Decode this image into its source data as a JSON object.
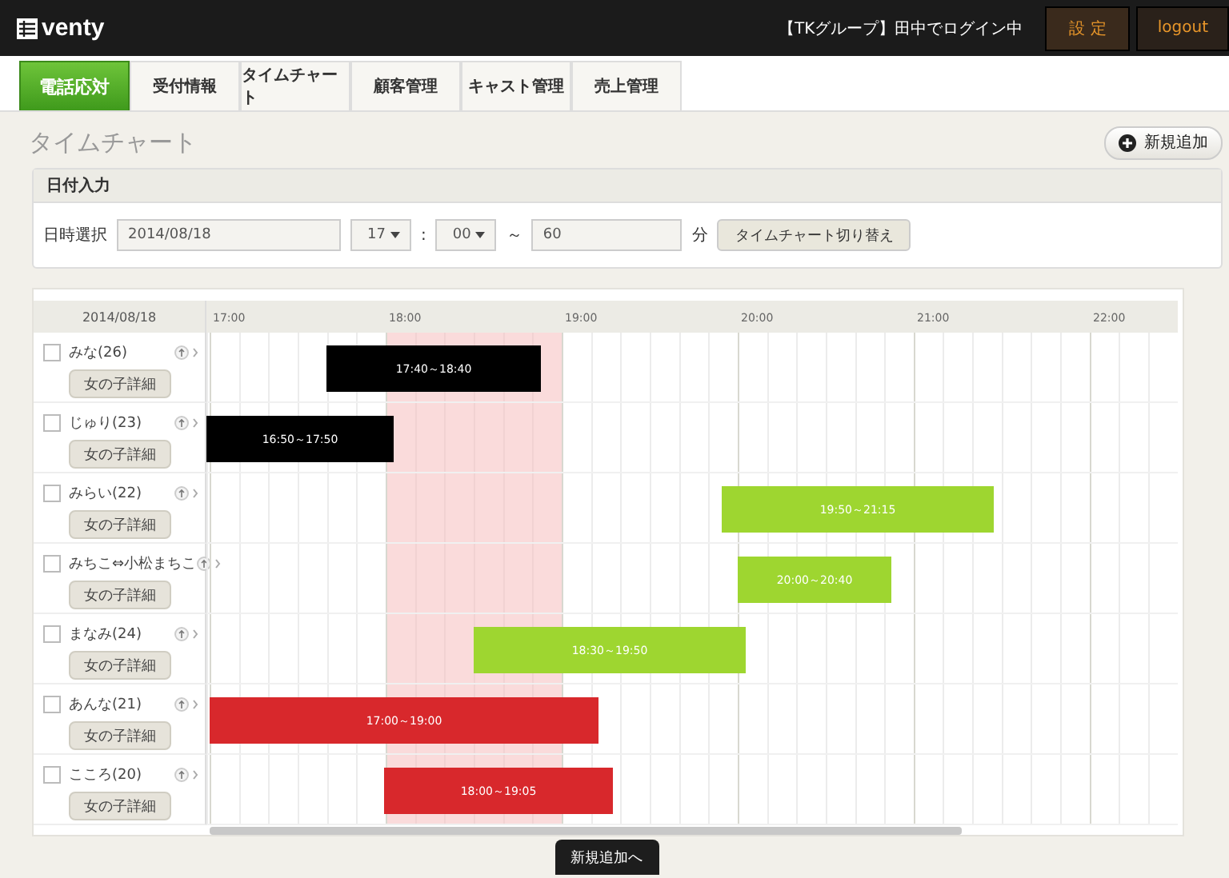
{
  "header": {
    "logo": "venty",
    "login_status": "【TKグループ】田中でログイン中",
    "buttons": [
      "設 定",
      "logout"
    ]
  },
  "tabs": [
    {
      "label": "電話応対",
      "selected": true
    },
    {
      "label": "受付情報",
      "selected": false
    },
    {
      "label": "タイムチャート",
      "selected": false
    },
    {
      "label": "顧客管理",
      "selected": false
    },
    {
      "label": "キャスト管理",
      "selected": false
    },
    {
      "label": "売上管理",
      "selected": false
    }
  ],
  "page_title": "タイムチャート",
  "add_button": "新規追加",
  "date_panel": {
    "title": "日付入力",
    "label": "日時選択",
    "date": "2014/08/18",
    "hour": "17",
    "time_sep": ":",
    "minute": "00",
    "range_sep": "～",
    "duration": "60",
    "unit": "分",
    "switch_button": "タイムチャート切り替え"
  },
  "chart": {
    "date": "2014/08/18",
    "hours": [
      {
        "label": "17:00",
        "highlighted": false
      },
      {
        "label": "18:00",
        "highlighted": true
      },
      {
        "label": "19:00",
        "highlighted": false
      },
      {
        "label": "20:00",
        "highlighted": false
      },
      {
        "label": "21:00",
        "highlighted": false
      },
      {
        "label": "22:00",
        "highlighted": false
      }
    ],
    "casts": [
      {
        "name": "みな(26)",
        "checked": false,
        "detail_button": "女の子詳細",
        "booking": {
          "label": "17:40～18:40",
          "color": "#000000"
        }
      },
      {
        "name": "じゅり(23)",
        "checked": false,
        "detail_button": "女の子詳細",
        "booking": {
          "label": "16:50～17:50",
          "color": "#000000"
        }
      },
      {
        "name": "みらい(22)",
        "checked": false,
        "detail_button": "女の子詳細",
        "booking": {
          "label": "19:50～21:15",
          "color": "#9ed630"
        }
      },
      {
        "name": "みちこ⇔小松まちこ",
        "checked": false,
        "detail_button": "女の子詳細",
        "booking": {
          "label": "20:00～20:40",
          "color": "#9ed630"
        }
      },
      {
        "name": "まなみ(24)",
        "checked": false,
        "detail_button": "女の子詳細",
        "booking": {
          "label": "18:30～19:50",
          "color": "#9ed630"
        }
      },
      {
        "name": "あんな(21)",
        "checked": false,
        "detail_button": "女の子詳細",
        "booking": {
          "label": "17:00～19:00",
          "color": "#d8282c"
        }
      },
      {
        "name": "こころ(20)",
        "checked": false,
        "detail_button": "女の子詳細",
        "booking": {
          "label": "18:00～19:05",
          "color": "#d8282c"
        }
      }
    ]
  },
  "footer_button": "新規追加へ"
}
